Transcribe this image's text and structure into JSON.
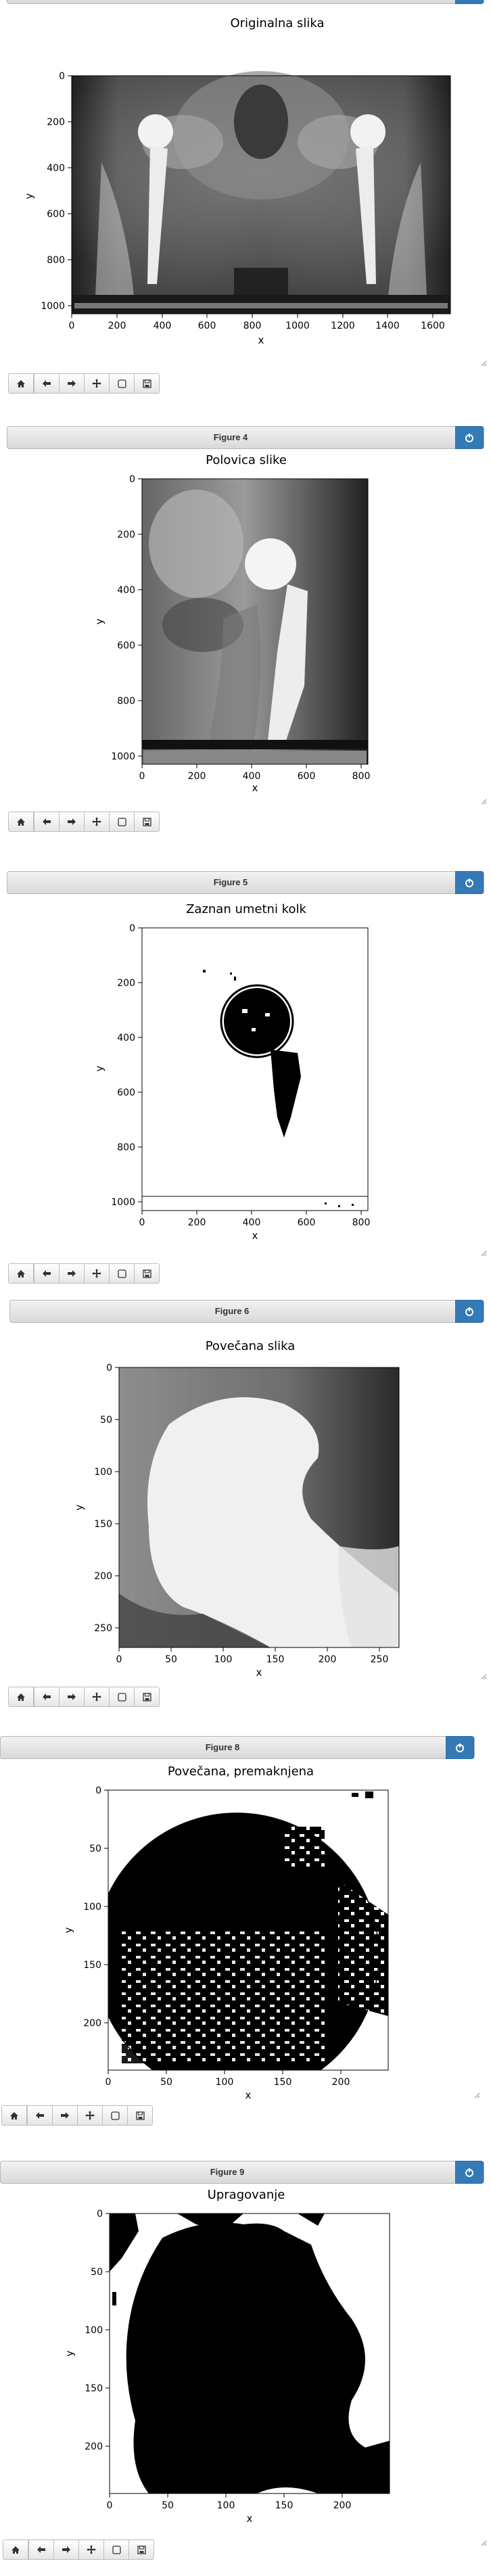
{
  "figures": [
    {
      "header": "",
      "title": "Originalna slika",
      "xlabel": "x",
      "ylabel": "y",
      "xticks": [
        "0",
        "200",
        "400",
        "600",
        "800",
        "1000",
        "1200",
        "1400",
        "1600"
      ],
      "yticks": [
        "0",
        "200",
        "400",
        "600",
        "800",
        "1000"
      ],
      "image": "xray-full"
    },
    {
      "header": "Figure 4",
      "title": "Polovica slike",
      "xlabel": "x",
      "ylabel": "y",
      "xticks": [
        "0",
        "200",
        "400",
        "600",
        "800"
      ],
      "yticks": [
        "0",
        "200",
        "400",
        "600",
        "800",
        "1000"
      ],
      "image": "xray-half"
    },
    {
      "header": "Figure 5",
      "title": "Zaznan umetni kolk",
      "xlabel": "x",
      "ylabel": "y",
      "xticks": [
        "0",
        "200",
        "400",
        "600",
        "800"
      ],
      "yticks": [
        "0",
        "200",
        "400",
        "600",
        "800",
        "1000"
      ],
      "image": "binary-detection"
    },
    {
      "header": "Figure 6",
      "title": "Povečana slika",
      "xlabel": "x",
      "ylabel": "y",
      "xticks": [
        "0",
        "50",
        "100",
        "150",
        "200",
        "250"
      ],
      "yticks": [
        "0",
        "50",
        "100",
        "150",
        "200",
        "250"
      ],
      "image": "zoom-gray"
    },
    {
      "header": "Figure 8",
      "title": "Povečana, premaknjena",
      "xlabel": "x",
      "ylabel": "y",
      "xticks": [
        "0",
        "50",
        "100",
        "150",
        "200"
      ],
      "yticks": [
        "0",
        "50",
        "100",
        "150",
        "200"
      ],
      "image": "zoom-binary"
    },
    {
      "header": "Figure 9",
      "title": "Upragovanje",
      "xlabel": "x",
      "ylabel": "y",
      "xticks": [
        "0",
        "50",
        "100",
        "150",
        "200"
      ],
      "yticks": [
        "0",
        "50",
        "100",
        "150",
        "200"
      ],
      "image": "threshold"
    }
  ],
  "toolbar_icons": [
    "home-icon",
    "back-arrow-icon",
    "forward-arrow-icon",
    "pan-icon",
    "zoom-rect-icon",
    "save-icon"
  ],
  "colors": {
    "header_button": "#337ab7",
    "header_bg": "#e3e3e3"
  }
}
